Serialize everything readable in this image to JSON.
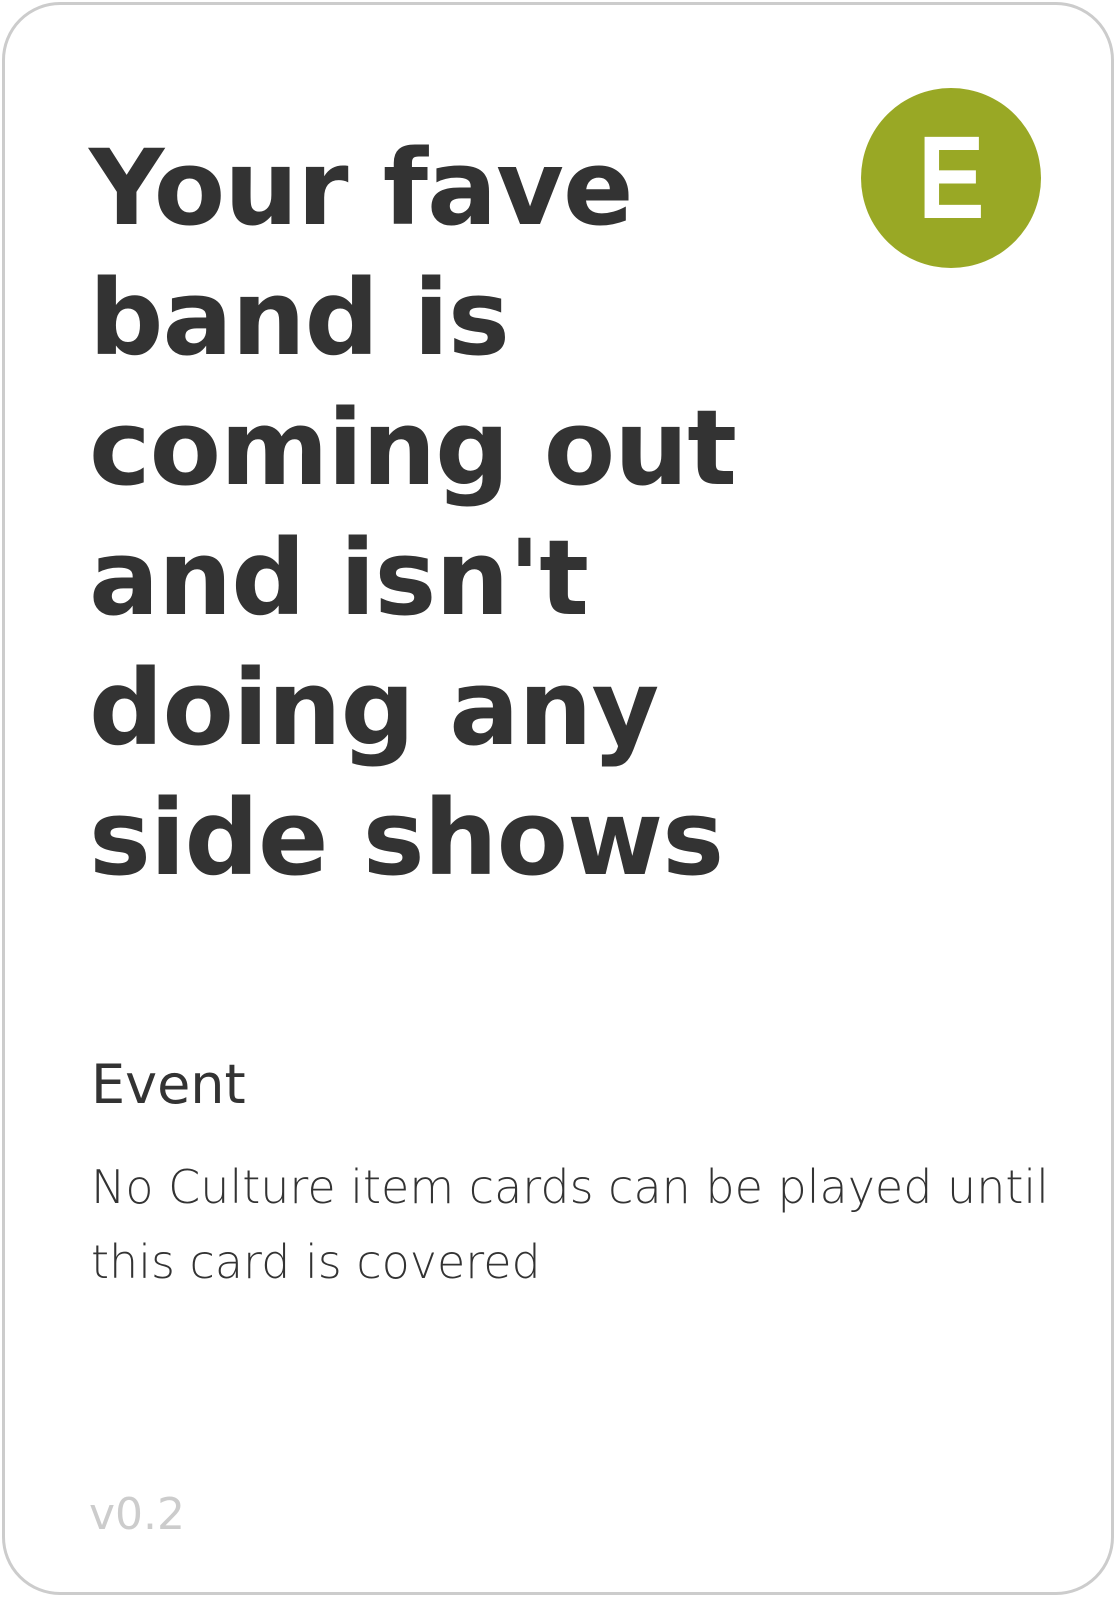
{
  "card": {
    "title": "Your fave band is coming out and isn't doing any side shows",
    "badge_letter": "E",
    "badge_color": "#99a825",
    "type": "Event",
    "description": "No Culture item cards can be played until this card is covered",
    "version": "v0.2"
  }
}
